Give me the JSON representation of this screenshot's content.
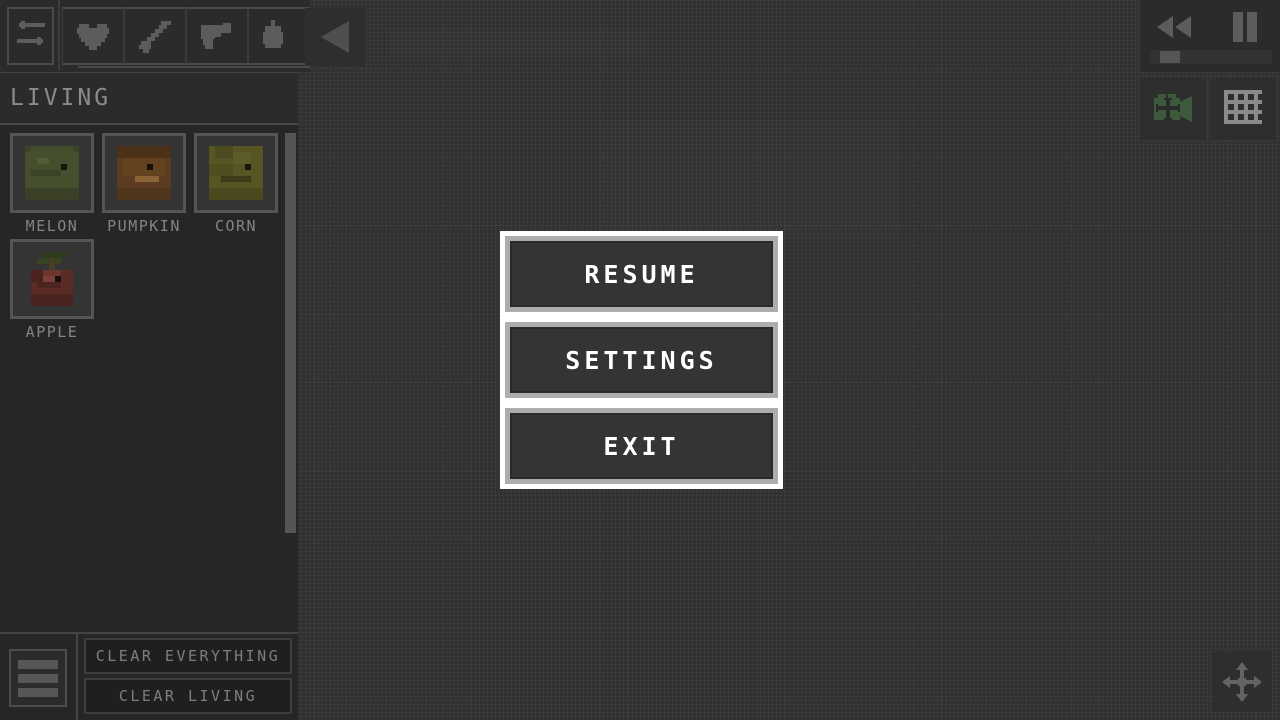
{
  "toolbar": {
    "swap_button": {
      "name": "swap-tool",
      "icon": "swap-arrows-icon"
    },
    "categories": [
      {
        "label": "Life",
        "icon": "heart-icon"
      },
      {
        "label": "Melee",
        "icon": "sword-icon"
      },
      {
        "label": "Guns",
        "icon": "gun-icon"
      },
      {
        "label": "Explosives",
        "icon": "bomb-icon"
      }
    ],
    "collapse_button": {
      "label": "Collapse panel",
      "icon": "triangle-left-icon"
    }
  },
  "library": {
    "header_title": "LIVING",
    "items": [
      {
        "label": "MELON",
        "sprite": "melon-sprite"
      },
      {
        "label": "PUMPKIN",
        "sprite": "pumpkin-sprite"
      },
      {
        "label": "CORN",
        "sprite": "corn-sprite"
      },
      {
        "label": "APPLE",
        "sprite": "apple-sprite"
      }
    ],
    "scrollbar": {
      "name": "library-scrollbar"
    }
  },
  "actionbar": {
    "menu_button": {
      "label": "Menu",
      "icon": "hamburger-icon"
    },
    "clear_everything_label": "CLEAR EVERYTHING",
    "clear_living_label": "CLEAR LIVING"
  },
  "playback": {
    "rewind_button": {
      "label": "Rewind",
      "icon": "rewind-icon"
    },
    "pause_button": {
      "label": "Pause",
      "icon": "pause-icon"
    },
    "speed_slider": {
      "label": "Speed",
      "value": 12
    }
  },
  "right_tools": [
    {
      "label": "Camera",
      "icon": "camera-move-icon",
      "color": "#3d5a3d"
    },
    {
      "label": "Grid",
      "icon": "grid-icon",
      "color": "#8a8a8a"
    }
  ],
  "pan_button": {
    "label": "Pan",
    "icon": "move-arrows-icon"
  },
  "pause_menu": {
    "resume_label": "RESUME",
    "settings_label": "SETTINGS",
    "exit_label": "EXIT"
  },
  "colors": {
    "background": "#313131",
    "panel": "#262626",
    "panel_light": "#2b2b2b",
    "border": "#4a4a4a",
    "text_muted": "#848484",
    "text_bright": "#ffffff",
    "menu_frame": "#ffffff",
    "menu_bevel": "#adadad",
    "camera_green": "#3d5a3d"
  }
}
